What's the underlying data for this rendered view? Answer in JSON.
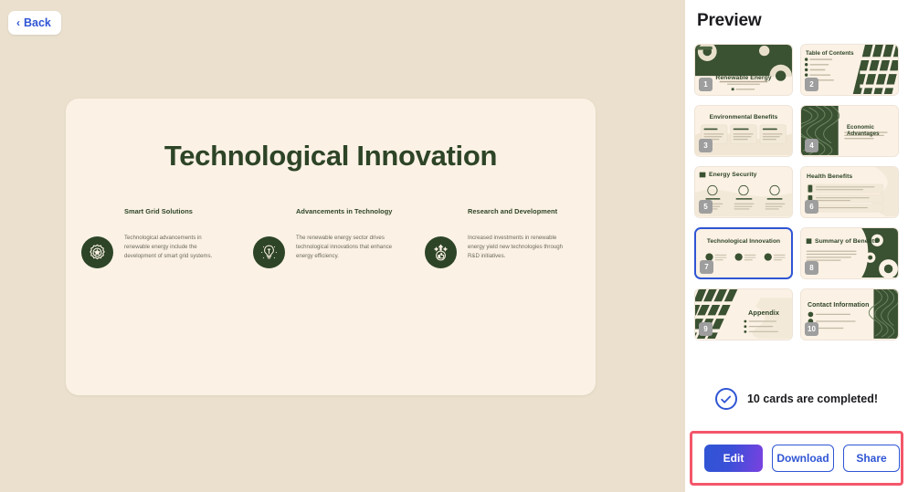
{
  "colors": {
    "canvas_bg": "#eae0cd",
    "slide_bg": "#fbf1e4",
    "slide_green": "#2d4427",
    "accent_blue": "#2f55d4",
    "highlight_red": "#f4566a",
    "thumb_num_gray": "#9e9e9e"
  },
  "back_button": {
    "label": "Back",
    "icon": "chevron-left-icon"
  },
  "slide": {
    "title": "Technological Innovation",
    "cards": [
      {
        "icon": "gear-star-icon",
        "heading": "Smart Grid Solutions",
        "body": "Technological advancements in renewable energy include the development of smart grid systems."
      },
      {
        "icon": "lightbulb-brain-icon",
        "heading": "Advancements in Technology",
        "body": "The renewable energy sector drives technological innovations that enhance energy efficiency."
      },
      {
        "icon": "thumbs-up-arrow-icon",
        "heading": "Research and Development",
        "body": "Increased investments in renewable energy yield new technologies through R&D initiatives."
      }
    ]
  },
  "preview": {
    "title": "Preview",
    "thumbnails": [
      {
        "number": "1",
        "title": "Renewable Energy",
        "selected": false
      },
      {
        "number": "2",
        "title": "Table of Contents",
        "selected": false
      },
      {
        "number": "3",
        "title": "Environmental Benefits",
        "selected": false
      },
      {
        "number": "4",
        "title": "Economic Advantages",
        "selected": false
      },
      {
        "number": "5",
        "title": "Energy Security",
        "selected": false
      },
      {
        "number": "6",
        "title": "Health Benefits",
        "selected": false
      },
      {
        "number": "7",
        "title": "Technological Innovation",
        "selected": true
      },
      {
        "number": "8",
        "title": "Summary of Benefits",
        "selected": false
      },
      {
        "number": "9",
        "title": "Appendix",
        "selected": false
      },
      {
        "number": "10",
        "title": "Contact Information",
        "selected": false
      }
    ],
    "status": {
      "icon": "check-circle-icon",
      "text": "10 cards are completed!"
    },
    "actions": {
      "edit_label": "Edit",
      "download_label": "Download",
      "share_label": "Share"
    }
  }
}
